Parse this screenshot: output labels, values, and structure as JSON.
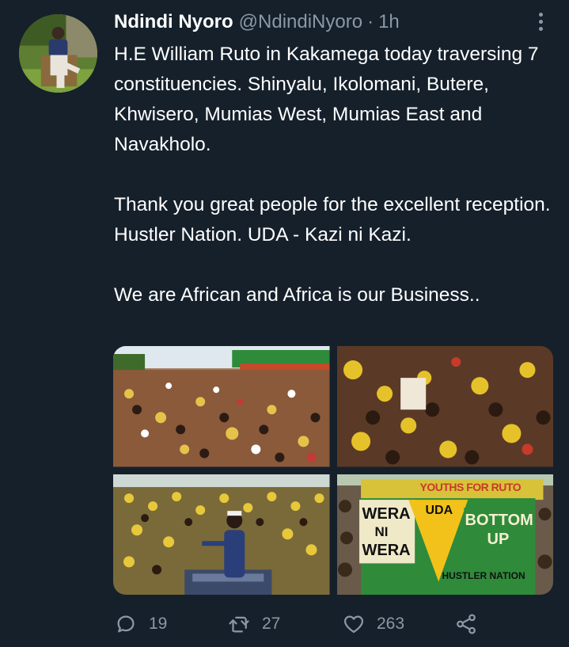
{
  "tweet": {
    "author_name": "Ndindi Nyoro",
    "author_handle": "@NdindiNyoro",
    "separator": "·",
    "time": "1h",
    "paragraphs": [
      "H.E William Ruto in Kakamega today traversing 7 constituencies. Shinyalu, Ikolomani, Butere, Khwisero, Mumias West, Mumias East and Navakholo.",
      "Thank you great people for the excellent reception. Hustler Nation. UDA - Kazi ni Kazi.",
      "We are African and Africa is our Business.."
    ],
    "photos": [
      {
        "name": "crowd-street-photo"
      },
      {
        "name": "crowd-placard-photo"
      },
      {
        "name": "ruto-addressing-crowd-photo"
      },
      {
        "name": "uda-banner-photo",
        "banner_texts": [
          "WERA",
          "NI",
          "WERA",
          "UDA",
          "BOTTOM",
          "UP",
          "HUSTLER NATION",
          "YOUTHS FOR RUTO"
        ]
      }
    ],
    "stats": {
      "replies": "19",
      "retweets": "27",
      "likes": "263"
    }
  },
  "icons": {
    "reply": "reply-icon",
    "retweet": "retweet-icon",
    "like": "heart-icon",
    "share": "share-icon",
    "more": "more-options-icon"
  },
  "colors": {
    "background": "#15202b",
    "text": "#ffffff",
    "secondary": "#8b98a5"
  }
}
